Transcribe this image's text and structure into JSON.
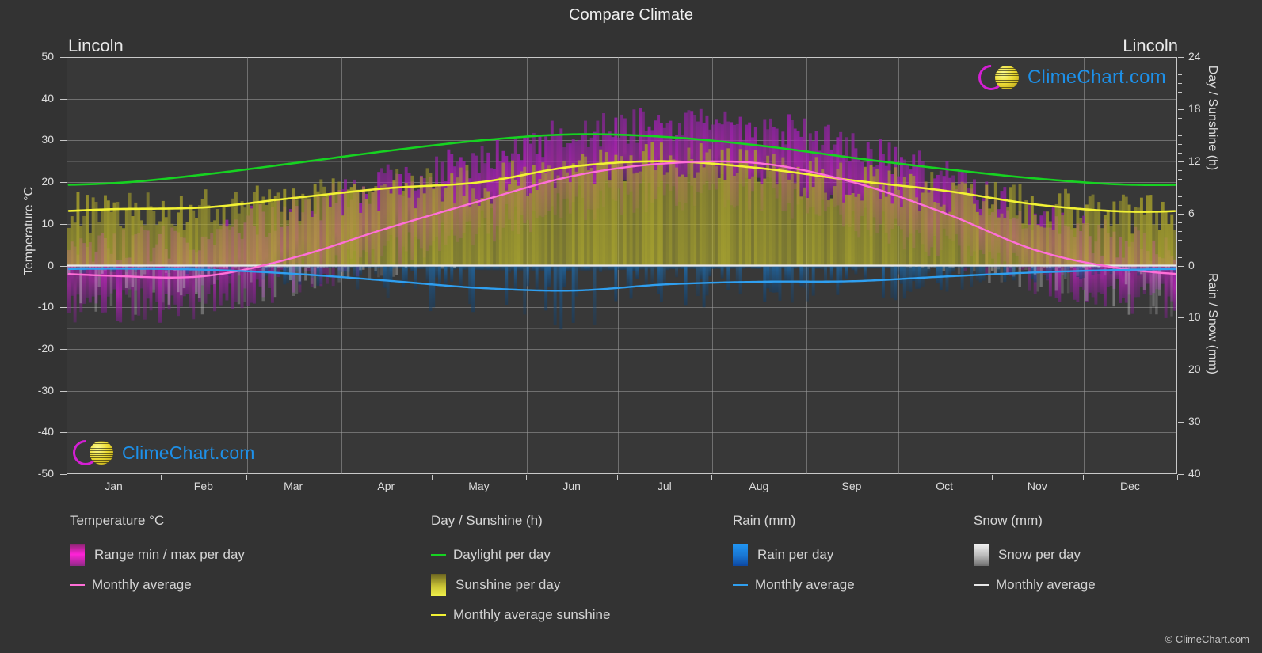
{
  "header": {
    "title": "Compare Climate",
    "location_left": "Lincoln",
    "location_right": "Lincoln"
  },
  "axes": {
    "left_title": "Temperature °C",
    "right_title_top": "Day / Sunshine (h)",
    "right_title_bottom": "Rain / Snow (mm)",
    "y_left_ticks": [
      "50",
      "40",
      "30",
      "20",
      "10",
      "0",
      "-10",
      "-20",
      "-30",
      "-40",
      "-50"
    ],
    "y_right_top_ticks": [
      "24",
      "18",
      "12",
      "6",
      "0"
    ],
    "y_right_bottom_ticks": [
      "0",
      "10",
      "20",
      "30",
      "40"
    ],
    "x_ticks": [
      "Jan",
      "Feb",
      "Mar",
      "Apr",
      "May",
      "Jun",
      "Jul",
      "Aug",
      "Sep",
      "Oct",
      "Nov",
      "Dec"
    ]
  },
  "brand": {
    "wordmark": "ClimeChart.com",
    "copyright": "© ClimeChart.com",
    "arc_color": "#d41fd4",
    "ball_color": "#ecdc36",
    "text_color": "#1e90e8"
  },
  "legend": {
    "groups": [
      {
        "title": "Temperature °C",
        "items": [
          {
            "label": "Range min / max per day",
            "marker": "gradient",
            "color": "#ff22d8"
          },
          {
            "label": "Monthly average",
            "marker": "line",
            "color": "#ff6fd8"
          }
        ]
      },
      {
        "title": "Day / Sunshine (h)",
        "items": [
          {
            "label": "Daylight per day",
            "marker": "line",
            "color": "#16d321"
          },
          {
            "label": "Sunshine per day",
            "marker": "gradient",
            "color": "#e6e03c"
          },
          {
            "label": "Monthly average sunshine",
            "marker": "line",
            "color": "#f2f234"
          }
        ]
      },
      {
        "title": "Rain (mm)",
        "items": [
          {
            "label": "Rain per day",
            "marker": "gradient",
            "color": "#1f8fe8"
          },
          {
            "label": "Monthly average",
            "marker": "line",
            "color": "#2f9ff0"
          }
        ]
      },
      {
        "title": "Snow (mm)",
        "items": [
          {
            "label": "Snow per day",
            "marker": "gradient",
            "color": "#d8d8d8"
          },
          {
            "label": "Monthly average",
            "marker": "line",
            "color": "#e8e8e8"
          }
        ]
      }
    ]
  },
  "chart_data": {
    "type": "area",
    "title": "Compare Climate",
    "subtitle": "Lincoln",
    "xlabel": "",
    "ylabel": "Temperature °C",
    "ylim": [
      -50,
      50
    ],
    "y2lim_top_hours": [
      0,
      24
    ],
    "y2lim_bottom_mm": [
      0,
      40
    ],
    "grid": true,
    "legend_position": "below-plot",
    "categories": [
      "Jan",
      "Feb",
      "Mar",
      "Apr",
      "May",
      "Jun",
      "Jul",
      "Aug",
      "Sep",
      "Oct",
      "Nov",
      "Dec"
    ],
    "series": [
      {
        "name": "Monthly average temperature",
        "unit": "°C",
        "axis": "left",
        "color": "#ff6fd8",
        "values": [
          -2.5,
          -2.5,
          2.0,
          9.0,
          15.5,
          21.5,
          24.5,
          24.5,
          20.0,
          12.5,
          3.5,
          -1.0
        ]
      },
      {
        "name": "Daily max temperature (range top)",
        "unit": "°C",
        "axis": "left",
        "color": "#c022c0",
        "values": [
          4.0,
          6.5,
          12.5,
          19.5,
          25.0,
          31.0,
          33.5,
          32.5,
          28.0,
          20.5,
          11.0,
          4.5
        ]
      },
      {
        "name": "Daily min temperature (range bottom)",
        "unit": "°C",
        "axis": "left",
        "color": "#c022c0",
        "values": [
          -9.5,
          -8.5,
          -3.0,
          3.0,
          9.0,
          14.5,
          17.5,
          17.0,
          11.5,
          4.5,
          -3.0,
          -8.0
        ]
      },
      {
        "name": "Daylight per day",
        "unit": "h",
        "axis": "right-top",
        "color": "#16d321",
        "values": [
          9.5,
          10.5,
          11.8,
          13.2,
          14.4,
          15.1,
          14.8,
          13.8,
          12.4,
          11.1,
          10.0,
          9.3
        ]
      },
      {
        "name": "Monthly average sunshine",
        "unit": "h",
        "axis": "right-top",
        "color": "#f2f234",
        "values": [
          6.5,
          6.7,
          7.8,
          8.9,
          9.6,
          11.4,
          12.0,
          11.2,
          9.8,
          8.6,
          7.0,
          6.2
        ]
      },
      {
        "name": "Monthly average rain",
        "unit": "mm",
        "axis": "right-bottom",
        "color": "#2f9ff0",
        "values": [
          0.6,
          0.8,
          1.6,
          2.9,
          4.3,
          4.8,
          3.6,
          3.1,
          3.0,
          2.1,
          1.3,
          0.8
        ]
      },
      {
        "name": "Monthly average snow",
        "unit": "mm",
        "axis": "right-bottom",
        "color": "#e8e8e8",
        "values": [
          0.4,
          0.4,
          0.3,
          0.1,
          0.0,
          0.0,
          0.0,
          0.0,
          0.0,
          0.05,
          0.25,
          0.4
        ]
      }
    ]
  }
}
